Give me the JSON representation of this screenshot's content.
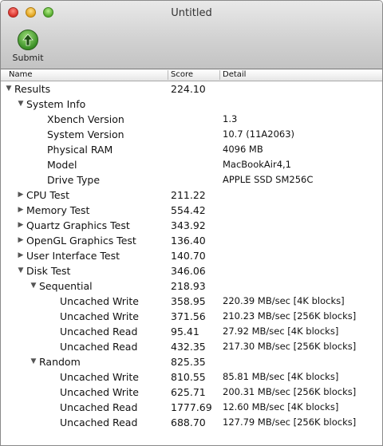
{
  "window": {
    "title": "Untitled"
  },
  "toolbar": {
    "submit_label": "Submit"
  },
  "columns": {
    "name": "Name",
    "score": "Score",
    "detail": "Detail"
  },
  "rows": [
    {
      "name": "Results",
      "score": "224.10",
      "detail": "",
      "level": 0,
      "disclosure": "open"
    },
    {
      "name": "System Info",
      "score": "",
      "detail": "",
      "level": 1,
      "disclosure": "open"
    },
    {
      "name": "Xbench Version",
      "score": "",
      "detail": "1.3",
      "level": 2,
      "disclosure": "none"
    },
    {
      "name": "System Version",
      "score": "",
      "detail": "10.7 (11A2063)",
      "level": 2,
      "disclosure": "none"
    },
    {
      "name": "Physical RAM",
      "score": "",
      "detail": "4096 MB",
      "level": 2,
      "disclosure": "none"
    },
    {
      "name": "Model",
      "score": "",
      "detail": "MacBookAir4,1",
      "level": 2,
      "disclosure": "none"
    },
    {
      "name": "Drive Type",
      "score": "",
      "detail": "APPLE SSD SM256C",
      "level": 2,
      "disclosure": "none"
    },
    {
      "name": "CPU Test",
      "score": "211.22",
      "detail": "",
      "level": 1,
      "disclosure": "closed"
    },
    {
      "name": "Memory Test",
      "score": "554.42",
      "detail": "",
      "level": 1,
      "disclosure": "closed"
    },
    {
      "name": "Quartz Graphics Test",
      "score": "343.92",
      "detail": "",
      "level": 1,
      "disclosure": "closed"
    },
    {
      "name": "OpenGL Graphics Test",
      "score": "136.40",
      "detail": "",
      "level": 1,
      "disclosure": "closed"
    },
    {
      "name": "User Interface Test",
      "score": "140.70",
      "detail": "",
      "level": 1,
      "disclosure": "closed"
    },
    {
      "name": "Disk Test",
      "score": "346.06",
      "detail": "",
      "level": 1,
      "disclosure": "open"
    },
    {
      "name": "Sequential",
      "score": "218.93",
      "detail": "",
      "level": 2,
      "disclosure": "open"
    },
    {
      "name": "Uncached Write",
      "score": "358.95",
      "detail": "220.39 MB/sec [4K blocks]",
      "level": 3,
      "disclosure": "none"
    },
    {
      "name": "Uncached Write",
      "score": "371.56",
      "detail": "210.23 MB/sec [256K blocks]",
      "level": 3,
      "disclosure": "none"
    },
    {
      "name": "Uncached Read",
      "score": "95.41",
      "detail": "27.92 MB/sec [4K blocks]",
      "level": 3,
      "disclosure": "none"
    },
    {
      "name": "Uncached Read",
      "score": "432.35",
      "detail": "217.30 MB/sec [256K blocks]",
      "level": 3,
      "disclosure": "none"
    },
    {
      "name": "Random",
      "score": "825.35",
      "detail": "",
      "level": 2,
      "disclosure": "open"
    },
    {
      "name": "Uncached Write",
      "score": "810.55",
      "detail": "85.81 MB/sec [4K blocks]",
      "level": 3,
      "disclosure": "none"
    },
    {
      "name": "Uncached Write",
      "score": "625.71",
      "detail": "200.31 MB/sec [256K blocks]",
      "level": 3,
      "disclosure": "none"
    },
    {
      "name": "Uncached Read",
      "score": "1777.69",
      "detail": "12.60 MB/sec [4K blocks]",
      "level": 3,
      "disclosure": "none"
    },
    {
      "name": "Uncached Read",
      "score": "688.70",
      "detail": "127.79 MB/sec [256K blocks]",
      "level": 3,
      "disclosure": "none"
    }
  ]
}
